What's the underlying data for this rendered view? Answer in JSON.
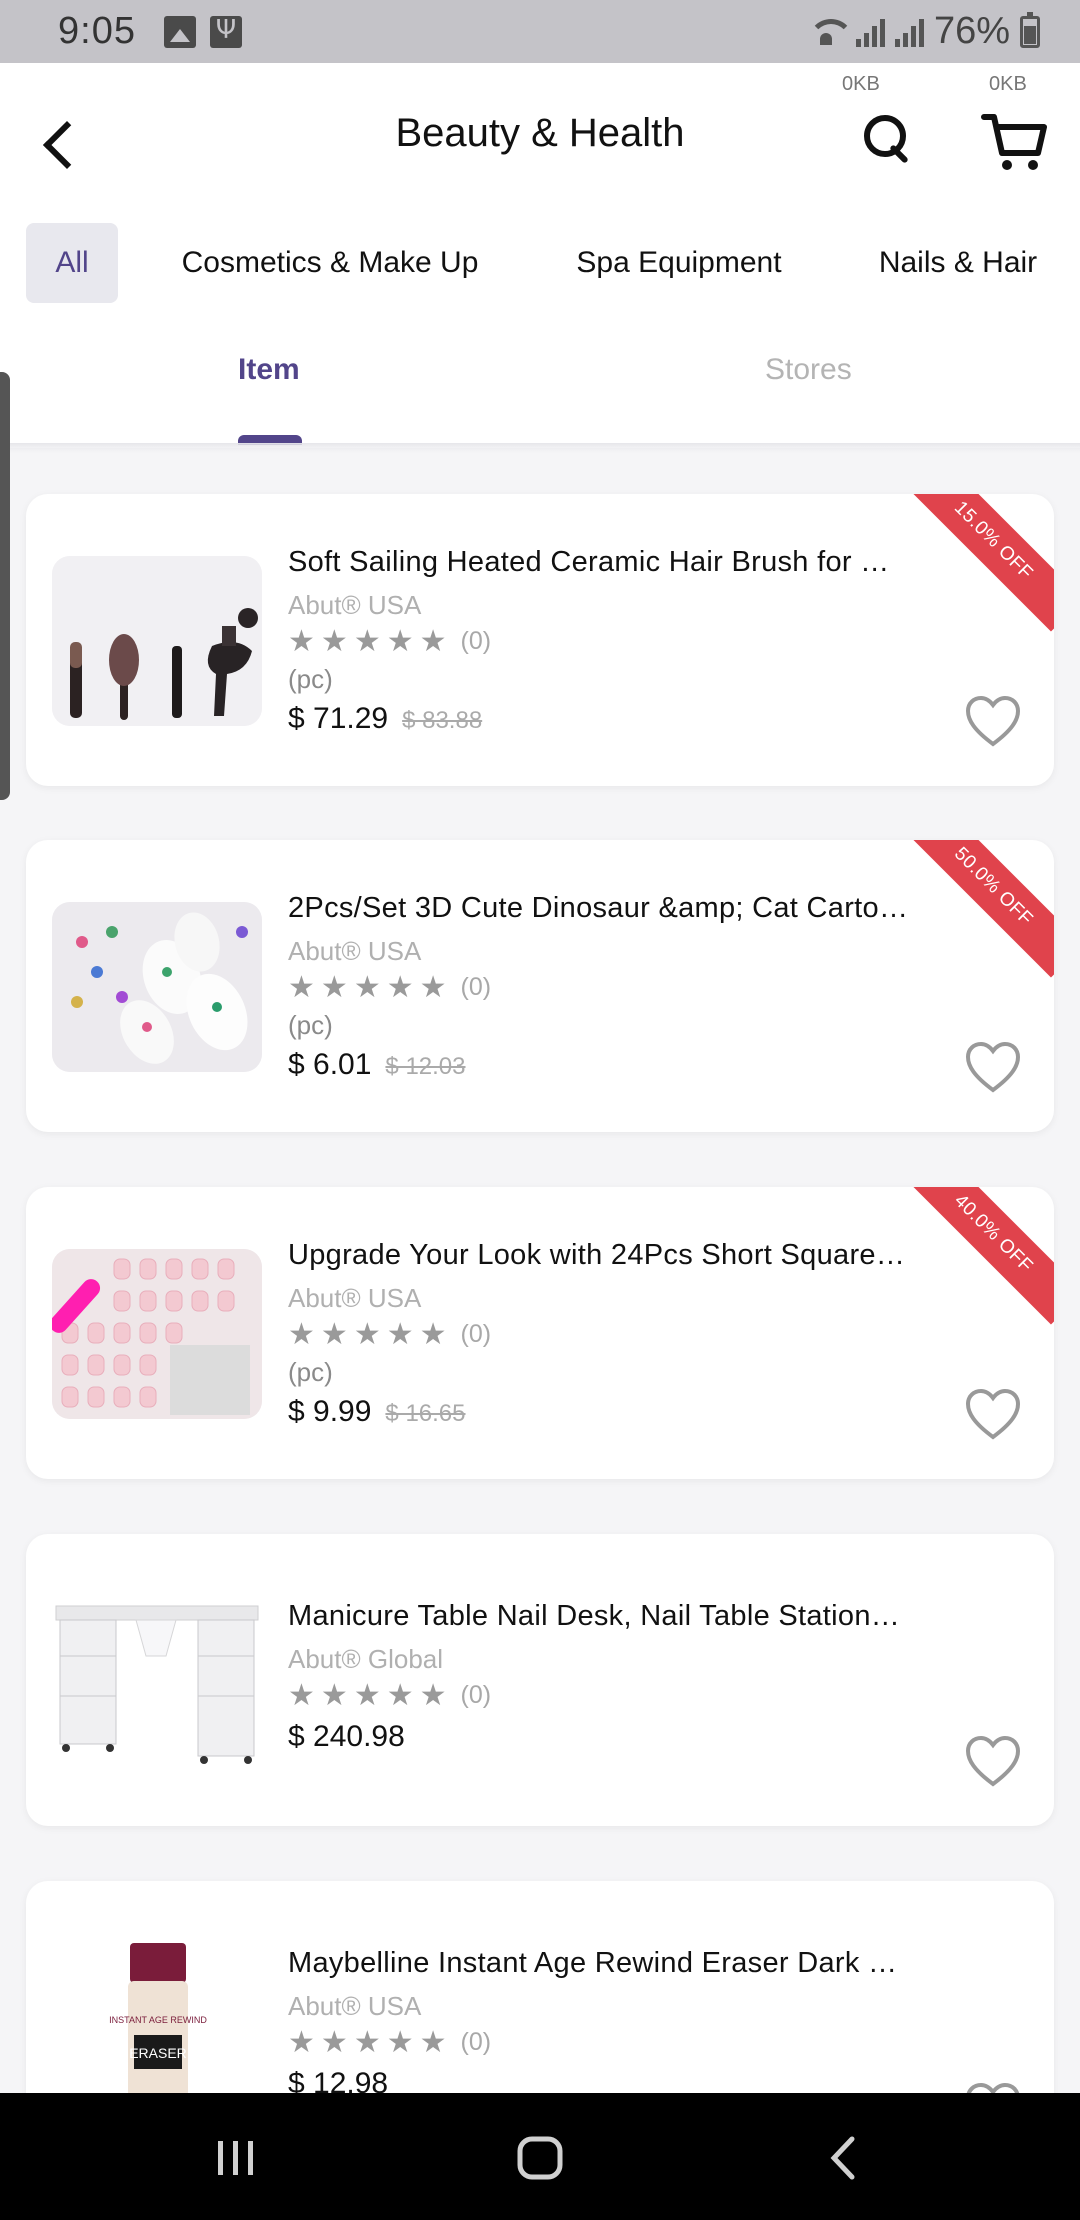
{
  "status_bar": {
    "time": "9:05",
    "battery": "76%"
  },
  "header": {
    "title": "Beauty & Health",
    "search_data_label": "0KB",
    "cart_data_label": "0KB"
  },
  "categories": [
    {
      "label": "All",
      "active": true
    },
    {
      "label": "Cosmetics & Make Up",
      "active": false
    },
    {
      "label": "Spa Equipment",
      "active": false
    },
    {
      "label": "Nails & Hair",
      "active": false
    }
  ],
  "tabs": [
    {
      "label": "Item",
      "active": true
    },
    {
      "label": "Stores",
      "active": false
    }
  ],
  "products": [
    {
      "title": "Soft Sailing Heated Ceramic Hair Brush for …",
      "store": "Abut® USA",
      "rating_count": "(0)",
      "unit": "(pc)",
      "price": "$ 71.29",
      "old_price": "$ 83.88",
      "discount": "15.0% OFF"
    },
    {
      "title": "2Pcs/Set 3D Cute Dinosaur &amp; Cat Carto…",
      "store": "Abut® USA",
      "rating_count": "(0)",
      "unit": "(pc)",
      "price": "$ 6.01",
      "old_price": "$ 12.03",
      "discount": "50.0% OFF"
    },
    {
      "title": "Upgrade Your Look with 24Pcs Short Square…",
      "store": "Abut® USA",
      "rating_count": "(0)",
      "unit": "(pc)",
      "price": "$ 9.99",
      "old_price": "$ 16.65",
      "discount": "40.0% OFF"
    },
    {
      "title": "Manicure Table Nail Desk, Nail Table Station…",
      "store": "Abut® Global",
      "rating_count": "(0)",
      "unit": "",
      "price": "$ 240.98",
      "old_price": "",
      "discount": ""
    },
    {
      "title": "Maybelline Instant Age Rewind Eraser Dark …",
      "store": "Abut® USA",
      "rating_count": "(0)",
      "unit": "",
      "price": "$ 12.98",
      "old_price": "",
      "discount": ""
    }
  ],
  "product_image_text": {
    "eraser_label": "ERASER",
    "bottle_label": "INSTANT AGE REWIND"
  },
  "colors": {
    "accent": "#52458a",
    "discount_ribbon": "#e0434c",
    "star": "#9a9a9a"
  },
  "icons": [
    "back-arrow-icon",
    "search-icon",
    "cart-icon",
    "heart-icon",
    "star-icon",
    "recents-icon",
    "home-icon",
    "back-icon"
  ]
}
